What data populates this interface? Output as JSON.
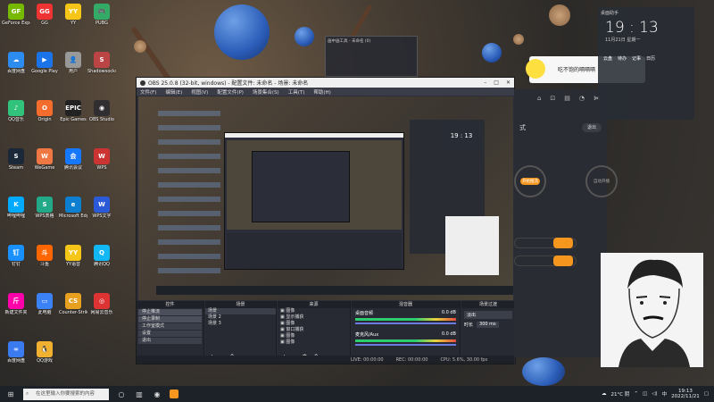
{
  "desktop_icons": [
    {
      "label": "GeForce Experience",
      "color": "#76b900",
      "glyph": "GF"
    },
    {
      "label": "GG",
      "color": "#e33",
      "glyph": "GG"
    },
    {
      "label": "YY",
      "color": "#f5c518",
      "glyph": "YY"
    },
    {
      "label": "PUBG",
      "color": "#3a6",
      "glyph": "🎮"
    },
    {
      "label": "百度网盘",
      "color": "#2d8cf0",
      "glyph": "☁"
    },
    {
      "label": "Google Play",
      "color": "#1a73e8",
      "glyph": "▶"
    },
    {
      "label": "用户",
      "color": "#999",
      "glyph": "👤"
    },
    {
      "label": "Shadowsocks",
      "color": "#b44",
      "glyph": "S"
    },
    {
      "label": "QQ音乐",
      "color": "#31c27c",
      "glyph": "♪"
    },
    {
      "label": "Origin",
      "color": "#f56c2d",
      "glyph": "O"
    },
    {
      "label": "Epic Games",
      "color": "#222",
      "glyph": "EPIC"
    },
    {
      "label": "OBS Studio",
      "color": "#302e31",
      "glyph": "◉"
    },
    {
      "label": "Steam",
      "color": "#1b2838",
      "glyph": "S"
    },
    {
      "label": "WeGame",
      "color": "#e74",
      "glyph": "W"
    },
    {
      "label": "腾讯会议",
      "color": "#1677ff",
      "glyph": "会"
    },
    {
      "label": "WPS",
      "color": "#c33",
      "glyph": "W"
    },
    {
      "label": "哔哩哔哩",
      "color": "#0af",
      "glyph": "K"
    },
    {
      "label": "WPS表格",
      "color": "#2a8",
      "glyph": "S"
    },
    {
      "label": "Microsoft Edge",
      "color": "#0c7fd1",
      "glyph": "e"
    },
    {
      "label": "WPS文字",
      "color": "#2a5ad8",
      "glyph": "W"
    },
    {
      "label": "钉钉",
      "color": "#1890ff",
      "glyph": "钉"
    },
    {
      "label": "斗鱼",
      "color": "#f60",
      "glyph": "斗"
    },
    {
      "label": "YY语音",
      "color": "#f5c518",
      "glyph": "YY"
    },
    {
      "label": "腾讯QQ",
      "color": "#12b7f5",
      "glyph": "Q"
    },
    {
      "label": "新建文件夹",
      "color": "#f0a",
      "glyph": "斤"
    },
    {
      "label": "此电脑",
      "color": "#3b82f6",
      "glyph": "▭"
    },
    {
      "label": "Counter-Strike Global",
      "color": "#e8a020",
      "glyph": "CS"
    },
    {
      "label": "网易云音乐",
      "color": "#d33",
      "glyph": "◎"
    },
    {
      "label": "百度网盘",
      "color": "#3a7bf0",
      "glyph": "∞"
    },
    {
      "label": "QQ游戏",
      "color": "#f0b030",
      "glyph": "🐧"
    }
  ],
  "obs": {
    "title": "OBS 25.0.8 (32-bit, windows) - 配置文件: 未命名 - 场景: 未命名",
    "menu": [
      "文件(F)",
      "编辑(E)",
      "视图(V)",
      "配置文件(P)",
      "场景集合(S)",
      "工具(T)",
      "帮助(H)"
    ],
    "docks": {
      "controls": {
        "title": "控件",
        "buttons": [
          "停止推流",
          "停止录制",
          "工作室模式",
          "设置",
          "退出"
        ]
      },
      "scenes": {
        "title": "场景",
        "items": [
          "场景",
          "场景 2",
          "场景 3"
        ]
      },
      "sources": {
        "title": "来源",
        "items": [
          "图像",
          "显示捕获",
          "图像",
          "窗口捕获",
          "图像",
          "图像"
        ]
      },
      "mixer": {
        "title": "混音器",
        "tracks": [
          {
            "name": "桌面音频",
            "db": "0.0 dB"
          },
          {
            "name": "麦克风/Aux",
            "db": "0.0 dB"
          }
        ]
      },
      "transitions": {
        "title": "场景过渡",
        "type": "淡出",
        "duration_label": "时长",
        "duration": "300 ms"
      }
    },
    "status": [
      "LIVE: 00:00:00",
      "REC: 00:00:00",
      "CPU: 5.6%, 30.00 fps"
    ]
  },
  "qq_popup": {
    "text": "吃不饱的嗝嗝嗝"
  },
  "side_panel": {
    "label1": "式",
    "button": "退出",
    "ring1": "开始推流",
    "ring2": "自动开播",
    "bar1": "60",
    "bar2": "60"
  },
  "clock_widget": {
    "title": "桌面助手",
    "time": "19 : 13",
    "date": "11月21日  星期一",
    "items": [
      "云盘",
      "待办",
      "记事",
      "日历"
    ]
  },
  "miniwin": {
    "title": "画中画工具 - 未命名 (0)"
  },
  "taskbar": {
    "search_placeholder": "在这里输入你要搜索的内容",
    "temp": "21°C 阴",
    "lang": "中",
    "time": "19:13",
    "date": "2022/11/21"
  }
}
